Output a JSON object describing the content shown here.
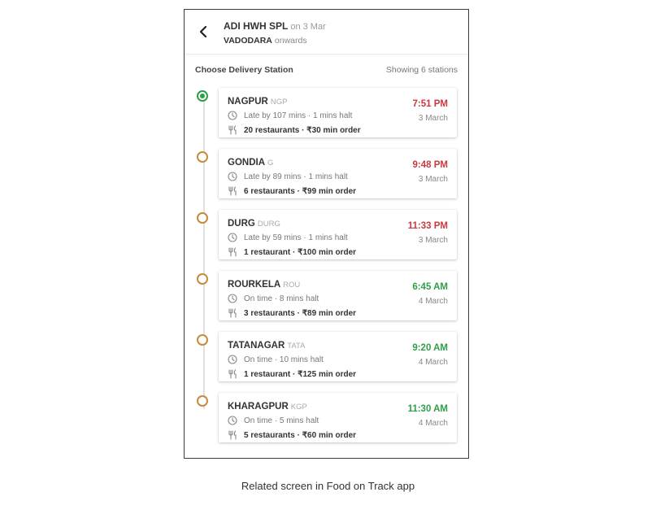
{
  "header": {
    "train": "ADI HWH SPL",
    "on_date": "on 3 Mar",
    "from": "VADODARA",
    "onwards": "onwards"
  },
  "section": {
    "title": "Choose Delivery Station",
    "count": "Showing 6 stations"
  },
  "colors": {
    "late": "#c9393f",
    "on_time": "#2e9e48",
    "pending_dot": "#c58b3a",
    "selected_dot": "#2e9e48"
  },
  "stations": [
    {
      "name": "NAGPUR",
      "code": "NGP",
      "status": "Late by 107 mins · 1 mins halt",
      "food": "20 restaurants · ₹30 min order",
      "time": "7:51 PM",
      "date": "3 March",
      "on_time": false,
      "selected": true
    },
    {
      "name": "GONDIA",
      "code": "G",
      "status": "Late by 89 mins · 1 mins halt",
      "food": "6 restaurants · ₹99 min order",
      "time": "9:48 PM",
      "date": "3 March",
      "on_time": false,
      "selected": false
    },
    {
      "name": "DURG",
      "code": "DURG",
      "status": "Late by 59 mins · 1 mins halt",
      "food": "1 restaurant · ₹100 min order",
      "time": "11:33 PM",
      "date": "3 March",
      "on_time": false,
      "selected": false
    },
    {
      "name": "ROURKELA",
      "code": "ROU",
      "status": "On time · 8 mins halt",
      "food": "3 restaurants · ₹89 min order",
      "time": "6:45 AM",
      "date": "4 March",
      "on_time": true,
      "selected": false
    },
    {
      "name": "TATANAGAR",
      "code": "TATA",
      "status": "On time · 10 mins halt",
      "food": "1 restaurant · ₹125 min order",
      "time": "9:20 AM",
      "date": "4 March",
      "on_time": true,
      "selected": false
    },
    {
      "name": "KHARAGPUR",
      "code": "KGP",
      "status": "On time · 5 mins halt",
      "food": "5 restaurants · ₹60 min order",
      "time": "11:30 AM",
      "date": "4 March",
      "on_time": true,
      "selected": false
    }
  ],
  "icons": {
    "back": "chevron-left-icon",
    "status": "clock-icon",
    "food": "fork-knife-icon"
  },
  "caption": "Related screen in Food on Track app"
}
